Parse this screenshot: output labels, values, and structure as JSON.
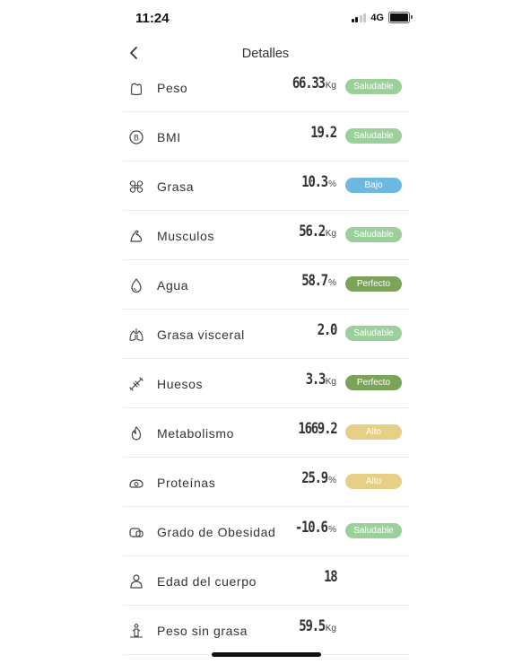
{
  "status_bar": {
    "time": "11:24",
    "network": "4G"
  },
  "header": {
    "title": "Detalles"
  },
  "colors": {
    "saludable": "#9cd09a",
    "bajo": "#6cb8e0",
    "perfecto": "#7ba35a",
    "alto": "#e8cf86"
  },
  "rows": [
    {
      "label": "Peso",
      "value": "66.33",
      "unit": "Kg",
      "badge": "Saludable",
      "badge_type": "saludable",
      "icon": "weight-icon"
    },
    {
      "label": "BMI",
      "value": "19.2",
      "unit": "",
      "badge": "Saludable",
      "badge_type": "saludable",
      "icon": "bmi-icon"
    },
    {
      "label": "Grasa",
      "value": "10.3",
      "unit": "%",
      "badge": "Bajo",
      "badge_type": "bajo",
      "icon": "fat-icon"
    },
    {
      "label": "Musculos",
      "value": "56.2",
      "unit": "Kg",
      "badge": "Saludable",
      "badge_type": "saludable",
      "icon": "muscle-icon"
    },
    {
      "label": "Agua",
      "value": "58.7",
      "unit": "%",
      "badge": "Perfecto",
      "badge_type": "perfecto",
      "icon": "water-drop-icon"
    },
    {
      "label": "Grasa visceral",
      "value": "2.0",
      "unit": "",
      "badge": "Saludable",
      "badge_type": "saludable",
      "icon": "lungs-icon"
    },
    {
      "label": "Huesos",
      "value": "3.3",
      "unit": "Kg",
      "badge": "Perfecto",
      "badge_type": "perfecto",
      "icon": "bone-icon"
    },
    {
      "label": "Metabolismo",
      "value": "1669.2",
      "unit": "",
      "badge": "Alto",
      "badge_type": "alto",
      "icon": "flame-icon"
    },
    {
      "label": "Proteínas",
      "value": "25.9",
      "unit": "%",
      "badge": "Alto",
      "badge_type": "alto",
      "icon": "protein-icon"
    },
    {
      "label": "Grado de Obesidad",
      "value": "-10.6",
      "unit": "%",
      "badge": "Saludable",
      "badge_type": "saludable",
      "icon": "obesity-icon"
    },
    {
      "label": "Edad del cuerpo",
      "value": "18",
      "unit": "",
      "badge": "",
      "badge_type": "",
      "icon": "body-age-icon"
    },
    {
      "label": "Peso sin grasa",
      "value": "59.5",
      "unit": "Kg",
      "badge": "",
      "badge_type": "",
      "icon": "lean-weight-icon"
    }
  ]
}
